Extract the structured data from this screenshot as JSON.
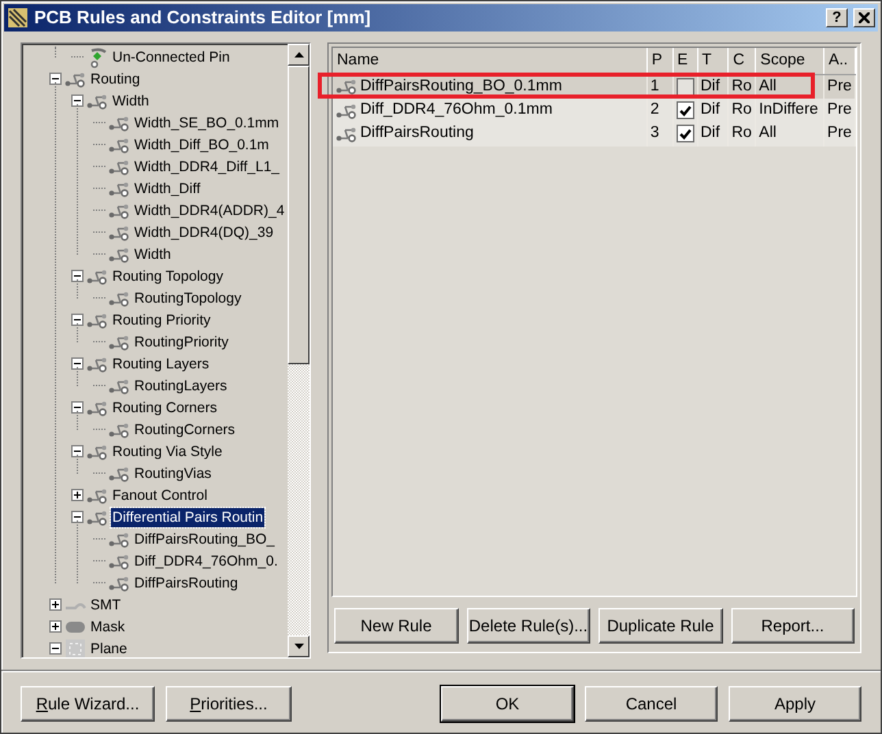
{
  "window": {
    "title": "PCB Rules and Constraints Editor [mm]",
    "help": "?"
  },
  "tree": [
    {
      "kind": "partial",
      "children": [
        {
          "label": "Un-Connected Pin",
          "kind": "pin",
          "selected": false
        }
      ]
    },
    {
      "label": "Routing",
      "expanded": true,
      "selected": false,
      "children": [
        {
          "label": "Width",
          "expanded": true,
          "selected": false,
          "children": [
            {
              "label": "Width_SE_BO_0.1mm",
              "selected": false
            },
            {
              "label": "Width_Diff_BO_0.1m",
              "selected": false
            },
            {
              "label": "Width_DDR4_Diff_L1_",
              "selected": false
            },
            {
              "label": "Width_Diff",
              "selected": false
            },
            {
              "label": "Width_DDR4(ADDR)_4",
              "selected": false
            },
            {
              "label": "Width_DDR4(DQ)_39",
              "selected": false
            },
            {
              "label": "Width",
              "selected": false
            }
          ]
        },
        {
          "label": "Routing Topology",
          "expanded": true,
          "selected": false,
          "children": [
            {
              "label": "RoutingTopology",
              "selected": false
            }
          ]
        },
        {
          "label": "Routing Priority",
          "expanded": true,
          "selected": false,
          "children": [
            {
              "label": "RoutingPriority",
              "selected": false
            }
          ]
        },
        {
          "label": "Routing Layers",
          "expanded": true,
          "selected": false,
          "children": [
            {
              "label": "RoutingLayers",
              "selected": false
            }
          ]
        },
        {
          "label": "Routing Corners",
          "expanded": true,
          "selected": false,
          "children": [
            {
              "label": "RoutingCorners",
              "selected": false
            }
          ]
        },
        {
          "label": "Routing Via Style",
          "expanded": true,
          "selected": false,
          "children": [
            {
              "label": "RoutingVias",
              "selected": false
            }
          ]
        },
        {
          "label": "Fanout Control",
          "expanded": false,
          "selected": false
        },
        {
          "label": "Differential Pairs Routin",
          "expanded": true,
          "selected": true,
          "children": [
            {
              "label": "DiffPairsRouting_BO_",
              "selected": false
            },
            {
              "label": "Diff_DDR4_76Ohm_0.",
              "selected": false
            },
            {
              "label": "DiffPairsRouting",
              "selected": false
            }
          ]
        }
      ]
    },
    {
      "label": "SMT",
      "kind": "smt",
      "expanded": false,
      "selected": false
    },
    {
      "label": "Mask",
      "kind": "mask",
      "expanded": false,
      "selected": false
    },
    {
      "label": "Plane",
      "kind": "plane",
      "expanded": true,
      "selected": false
    }
  ],
  "table": {
    "columns": [
      "Name",
      "P",
      "E",
      "T",
      "C",
      "Scope",
      "A.."
    ],
    "rows": [
      {
        "name": "DiffPairsRouting_BO_0.1mm",
        "priority": "1",
        "enabled": false,
        "type": "Dif",
        "category": "Ro",
        "scope": "All",
        "attributes": "Pre",
        "selected": true,
        "highlighted": true
      },
      {
        "name": "Diff_DDR4_76Ohm_0.1mm",
        "priority": "2",
        "enabled": true,
        "type": "Dif",
        "category": "Ro",
        "scope": "InDiffere",
        "attributes": "Pre",
        "selected": false,
        "highlighted": false
      },
      {
        "name": "DiffPairsRouting",
        "priority": "3",
        "enabled": true,
        "type": "Dif",
        "category": "Ro",
        "scope": "All",
        "attributes": "Pre",
        "selected": false,
        "highlighted": false
      }
    ]
  },
  "rule_buttons": [
    "New Rule",
    "Delete Rule(s)...",
    "Duplicate Rule",
    "Report..."
  ],
  "footer_left": [
    {
      "label": "Rule Wizard...",
      "underline_first": true
    },
    {
      "label": "Priorities...",
      "underline_first": true
    }
  ],
  "footer_right": [
    {
      "label": "OK",
      "default": true
    },
    {
      "label": "Cancel",
      "default": false
    },
    {
      "label": "Apply",
      "default": false
    }
  ]
}
